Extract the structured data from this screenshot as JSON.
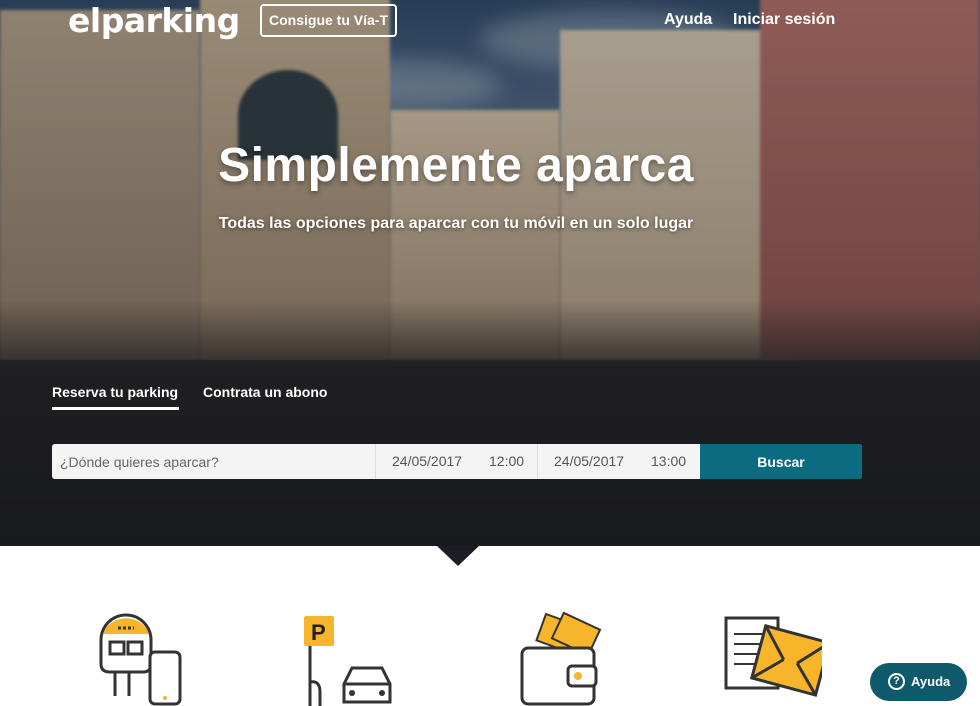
{
  "header": {
    "logo_text": "elparking",
    "via_t_button": "Consigue tu Vía-T",
    "nav": {
      "help": "Ayuda",
      "login": "Iniciar sesión"
    }
  },
  "hero": {
    "title": "Simplemente aparca",
    "subtitle": "Todas las opciones para aparcar con tu móvil en un solo lugar"
  },
  "search": {
    "tabs": [
      "Reserva tu parking",
      "Contrata un abono"
    ],
    "active_tab": "Reserva tu parking",
    "where_placeholder": "¿Dónde quieres aparcar?",
    "start_date": "24/05/2017",
    "start_time": "12:00",
    "end_date": "24/05/2017",
    "end_time": "13:00",
    "submit_label": "Buscar"
  },
  "features": {
    "icons": [
      "parking-meter-phone-icon",
      "parking-sign-car-icon",
      "wallet-cash-icon",
      "documents-envelope-icon"
    ]
  },
  "help_widget": {
    "label": "Ayuda"
  },
  "colors": {
    "primary": "#0b6b80",
    "accent": "#f7b52c",
    "help_widget": "#0e5a6b"
  }
}
